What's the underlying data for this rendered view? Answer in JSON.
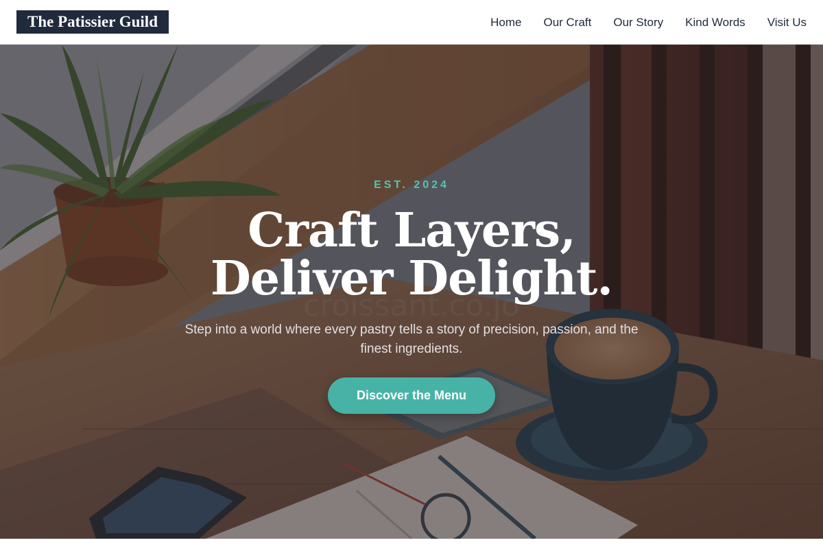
{
  "header": {
    "brand": "The Patissier Guild",
    "nav": [
      {
        "label": "Home"
      },
      {
        "label": "Our Craft"
      },
      {
        "label": "Our Story"
      },
      {
        "label": "Kind Words"
      },
      {
        "label": "Visit Us"
      }
    ]
  },
  "hero": {
    "eyebrow": "EST. 2024",
    "title_line1": "Craft Layers,",
    "title_line2": "Deliver Delight.",
    "subtitle": "Step into a world where every pastry tells a story of precision, passion, and the finest ingredients.",
    "cta_label": "Discover the Menu",
    "background": "cafe-table-coffee-photo"
  },
  "colors": {
    "brand_bg": "#1f2a3c",
    "accent": "#47b3a6",
    "eyebrow": "#58c2b0"
  }
}
